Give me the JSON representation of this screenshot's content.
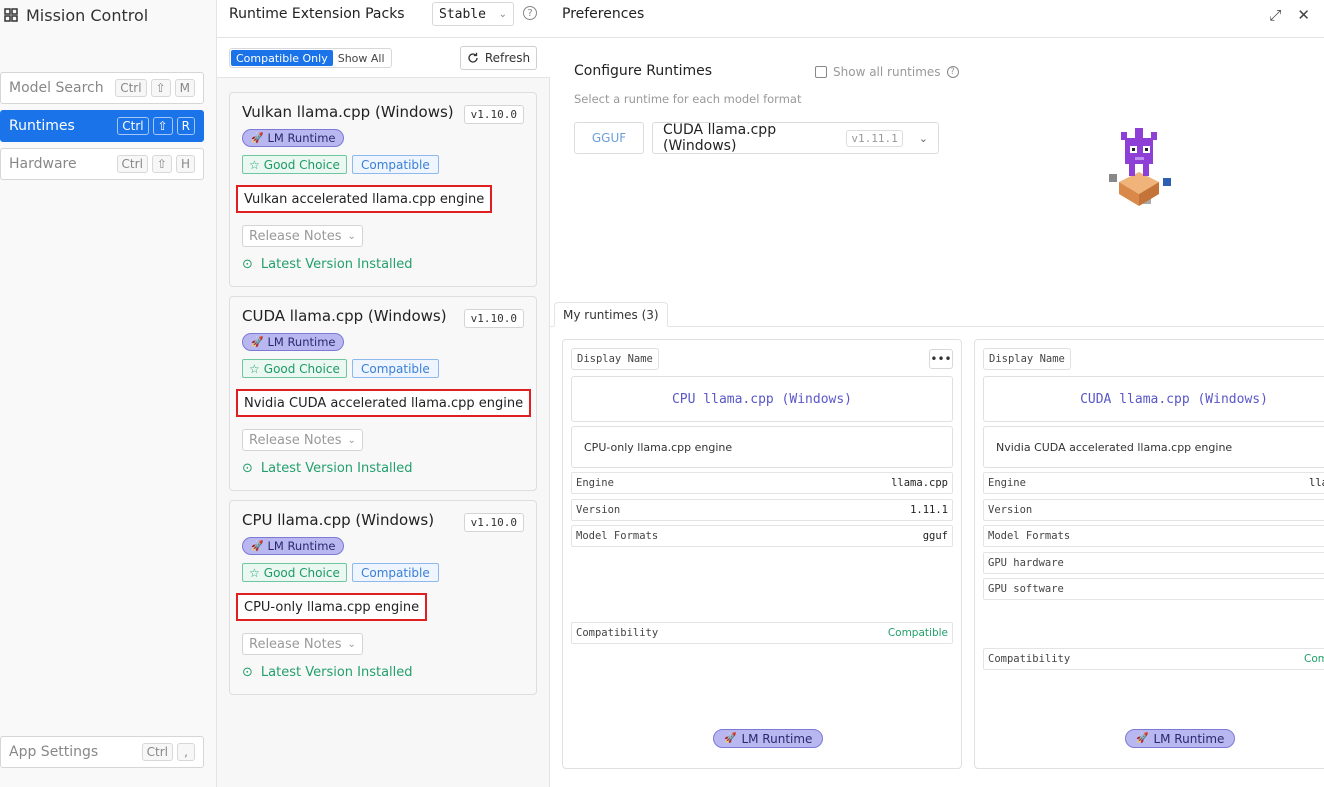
{
  "sidebar": {
    "title": "Mission Control",
    "items": [
      {
        "label": "Model Search",
        "keys": [
          "Ctrl",
          "⇧",
          "M"
        ]
      },
      {
        "label": "Runtimes",
        "keys": [
          "Ctrl",
          "⇧",
          "R"
        ]
      },
      {
        "label": "Hardware",
        "keys": [
          "Ctrl",
          "⇧",
          "H"
        ]
      }
    ],
    "settings": {
      "label": "App Settings",
      "keys": [
        "Ctrl",
        ","
      ]
    }
  },
  "extensions": {
    "title": "Runtime Extension Packs",
    "channel": "Stable",
    "filter": {
      "compatible_only": "Compatible Only",
      "show_all": "Show All"
    },
    "refresh": "Refresh",
    "cards": [
      {
        "name": "Vulkan llama.cpp (Windows)",
        "version": "v1.10.0",
        "tag": "LM Runtime",
        "good": "Good Choice",
        "compat": "Compatible",
        "description": "Vulkan accelerated llama.cpp engine",
        "notes": "Release Notes",
        "status": "Latest Version Installed"
      },
      {
        "name": "CUDA llama.cpp (Windows)",
        "version": "v1.10.0",
        "tag": "LM Runtime",
        "good": "Good Choice",
        "compat": "Compatible",
        "description": "Nvidia CUDA accelerated llama.cpp engine",
        "notes": "Release Notes",
        "status": "Latest Version Installed"
      },
      {
        "name": "CPU llama.cpp (Windows)",
        "version": "v1.10.0",
        "tag": "LM Runtime",
        "good": "Good Choice",
        "compat": "Compatible",
        "description": "CPU-only llama.cpp engine",
        "notes": "Release Notes",
        "status": "Latest Version Installed"
      }
    ]
  },
  "preferences": {
    "title": "Preferences",
    "configure_title": "Configure Runtimes",
    "show_all_runtimes": "Show all runtimes",
    "subtitle": "Select a runtime for each model format",
    "format": "GGUF",
    "selected_runtime": "CUDA llama.cpp (Windows)",
    "selected_version": "v1.11.1",
    "tab": "My runtimes (3)",
    "runtimes": [
      {
        "display_label": "Display Name",
        "name": "CPU llama.cpp (Windows)",
        "description": "CPU-only llama.cpp engine",
        "props": [
          {
            "key": "Engine",
            "value": "llama.cpp"
          },
          {
            "key": "Version",
            "value": "1.11.1"
          },
          {
            "key": "Model Formats",
            "value": "gguf"
          }
        ],
        "compat_key": "Compatibility",
        "compat_value": "Compatible",
        "tag": "LM Runtime"
      },
      {
        "display_label": "Display Name",
        "name": "CUDA llama.cpp (Windows)",
        "description": "Nvidia CUDA accelerated llama.cpp engine",
        "props": [
          {
            "key": "Engine",
            "value": "lla"
          },
          {
            "key": "Version",
            "value": ""
          },
          {
            "key": "Model Formats",
            "value": ""
          },
          {
            "key": "GPU hardware",
            "value": ""
          },
          {
            "key": "GPU software",
            "value": ""
          }
        ],
        "compat_key": "Compatibility",
        "compat_value": "Com",
        "tag": "LM Runtime"
      }
    ]
  },
  "colors": {
    "accent": "#1a73e8",
    "tag_purple": "#b9b7f0",
    "good_green": "#22a06b",
    "highlight_red": "#e02020"
  }
}
